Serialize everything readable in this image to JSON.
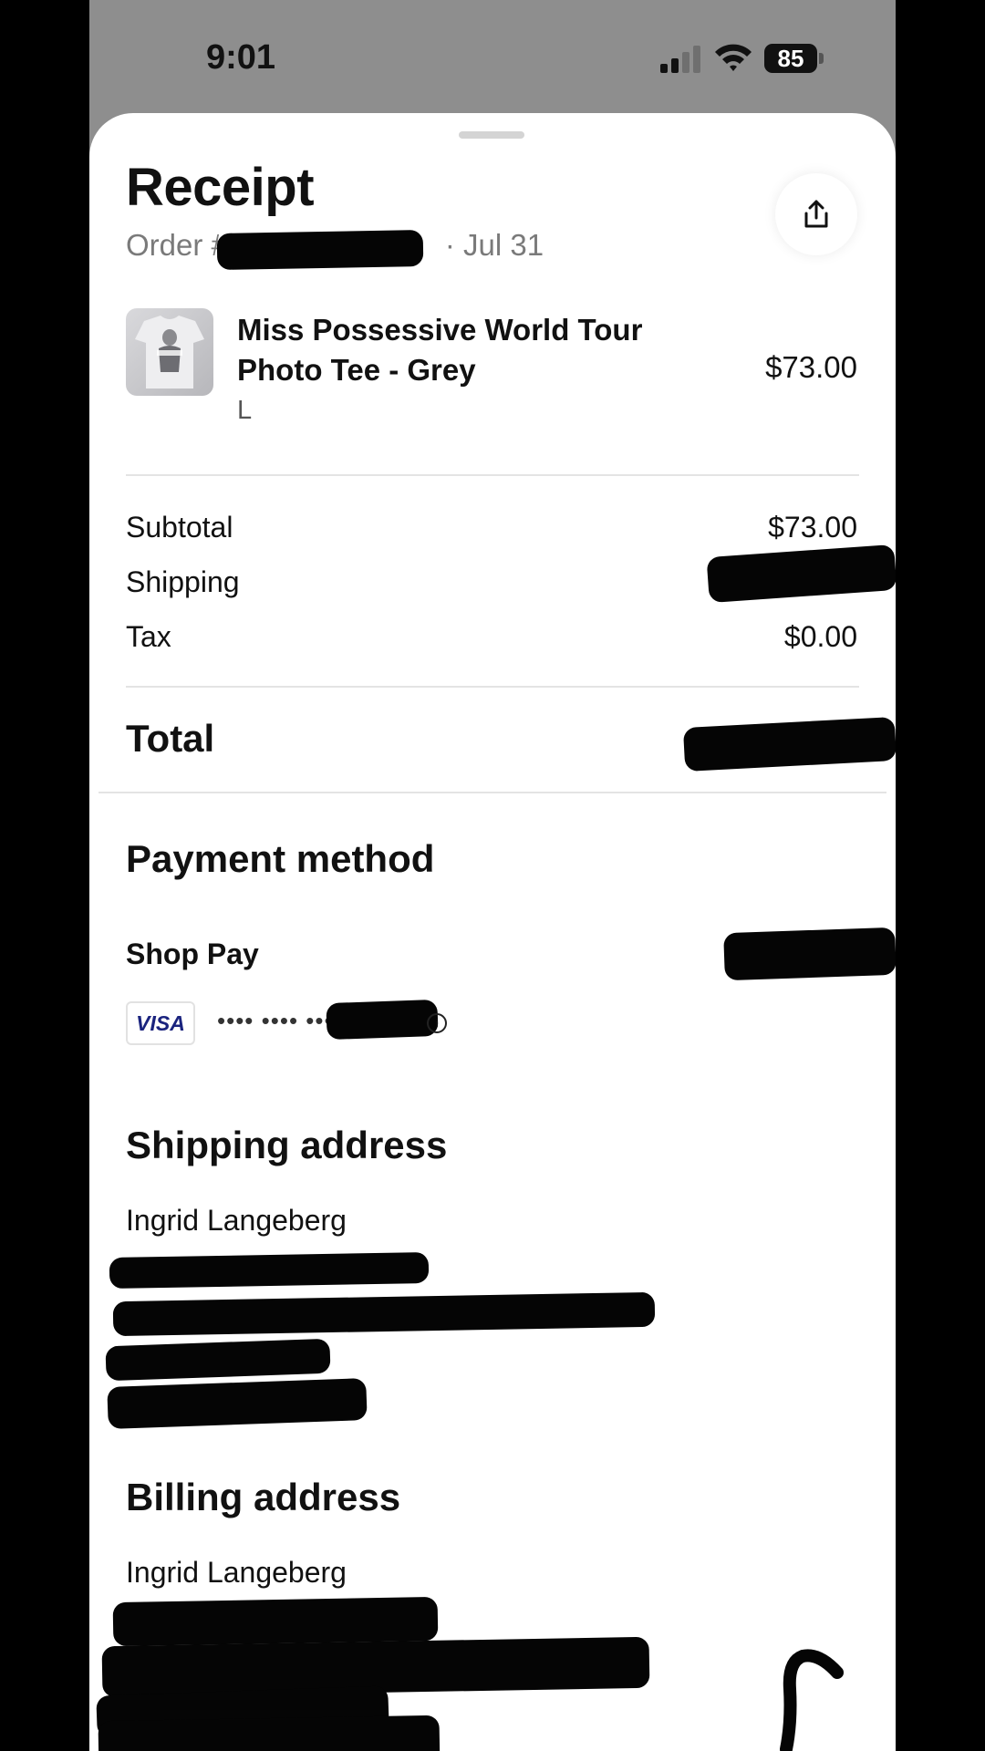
{
  "status_bar": {
    "time": "9:01",
    "battery": "85",
    "icons": [
      "cellular-signal-icon",
      "wifi-icon",
      "battery-icon"
    ]
  },
  "receipt": {
    "title": "Receipt",
    "order_prefix": "Order #",
    "order_date": "· Jul 31",
    "share_icon": "share-icon"
  },
  "item": {
    "name": "Miss Possessive World Tour Photo Tee - Grey",
    "variant": "L",
    "price": "$73.00"
  },
  "summary": {
    "subtotal_label": "Subtotal",
    "subtotal_value": "$73.00",
    "shipping_label": "Shipping",
    "shipping_value": "",
    "tax_label": "Tax",
    "tax_value": "$0.00",
    "total_label": "Total",
    "total_value": ""
  },
  "payment": {
    "heading": "Payment method",
    "provider": "Shop Pay",
    "card_brand": "VISA",
    "card_mask": "•••• •••• ••••"
  },
  "shipping_address": {
    "heading": "Shipping address",
    "name": "Ingrid Langeberg"
  },
  "billing_address": {
    "heading": "Billing address",
    "name": "Ingrid Langeberg"
  },
  "colors": {
    "sheet": "#ffffff",
    "backdrop": "#8e8e8e",
    "redaction": "#050505",
    "visa_blue": "#1a237e"
  }
}
